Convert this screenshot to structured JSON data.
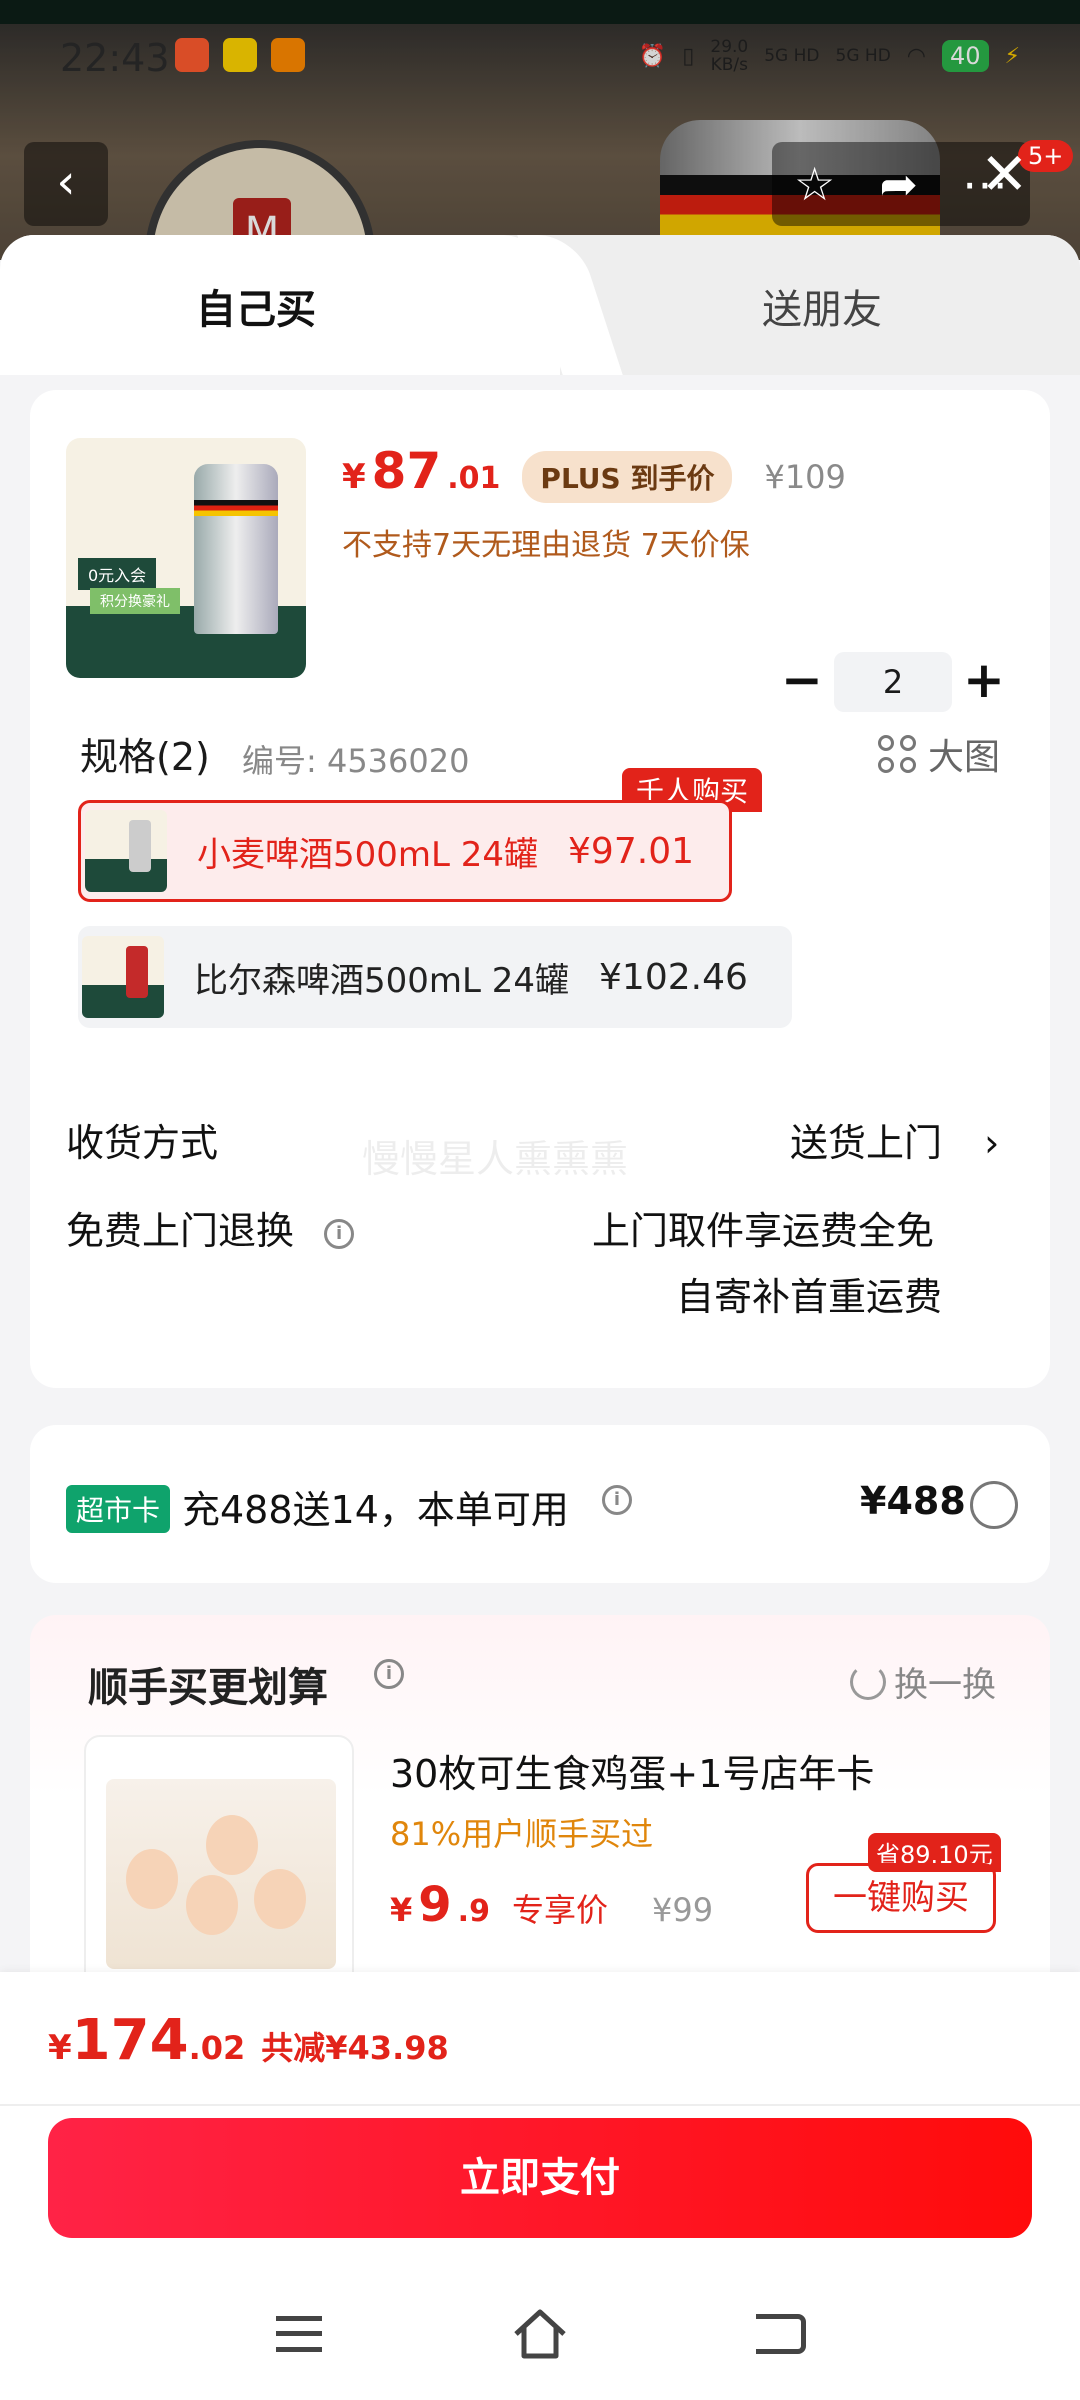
{
  "status_bar": {
    "time": "22:43",
    "net_speed_value": "29.0",
    "net_speed_unit": "KB/s",
    "sig1": "5G HD",
    "sig2": "5G HD",
    "battery": "40"
  },
  "header": {
    "badge": "5+"
  },
  "tabs": [
    {
      "label": "自己买",
      "active": true
    },
    {
      "label": "送朋友",
      "active": false
    }
  ],
  "product": {
    "currency": "¥",
    "price_int": "87",
    "price_dec": ".01",
    "plus_label": "PLUS 到手价",
    "original_price": "¥109",
    "notice": "不支持7天无理由退货  7天价保",
    "thumb_tag": "0元入会",
    "thumb_tag2": "积分换豪礼",
    "quantity": "2",
    "minus": "−",
    "plus": "+"
  },
  "spec": {
    "title": "规格(2)",
    "code": "编号: 4536020",
    "big_image": "大图",
    "hot_tag": "千人购买",
    "options": [
      {
        "label": "小麦啤酒500mL 24罐",
        "price": "¥97.01",
        "selected": true
      },
      {
        "label": "比尔森啤酒500mL 24罐",
        "price": "¥102.46",
        "selected": false
      }
    ]
  },
  "delivery": {
    "label": "收货方式",
    "value": "送货上门",
    "chevron": "›",
    "watermark": "慢慢星人熏熏熏"
  },
  "returns": {
    "label": "免费上门退换",
    "line1": "上门取件享运费全免",
    "line2": "自寄补首重运费"
  },
  "market_card": {
    "badge": "超市卡",
    "text": "充488送14，本单可用",
    "price": "¥488"
  },
  "addon": {
    "title": "顺手买更划算",
    "swap": "换一换",
    "name": "30枚可生食鸡蛋+1号店年卡",
    "stat": "81%用户顺手买过",
    "currency": "¥",
    "price_int": "9",
    "price_dec": ".9",
    "price_tag": "专享价",
    "original": "¥99",
    "save_tag": "省89.10元",
    "buy_label": "一键购买"
  },
  "footer": {
    "currency": "¥",
    "total_int": "174",
    "total_dec": ".02",
    "saved": "共减¥43.98",
    "pay_label": "立即支付"
  },
  "colors": {
    "accent": "#e2231a",
    "orange": "#e0860b",
    "green": "#0fa36c"
  }
}
